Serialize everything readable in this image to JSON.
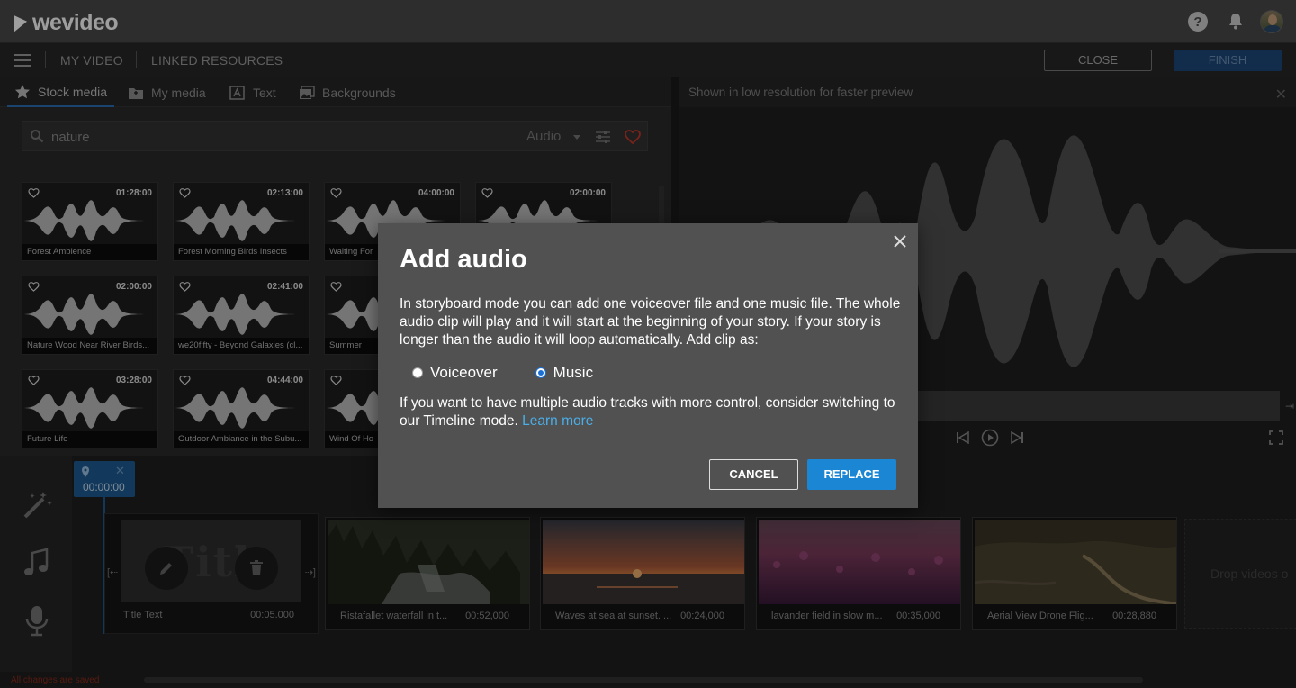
{
  "app": {
    "logo_text": "wevideo"
  },
  "header": {
    "icons": [
      "help-icon",
      "bell-icon",
      "avatar"
    ]
  },
  "subbar": {
    "my_video": "MY VIDEO",
    "linked_resources": "LINKED RESOURCES",
    "close_label": "CLOSE",
    "finish_label": "FINISH"
  },
  "media": {
    "tabs": [
      {
        "label": "Stock media",
        "icon": "star-icon"
      },
      {
        "label": "My media",
        "icon": "folder-icon"
      },
      {
        "label": "Text",
        "icon": "text-icon"
      },
      {
        "label": "Backgrounds",
        "icon": "image-icon"
      }
    ],
    "search": {
      "value": "nature",
      "placeholder": ""
    },
    "type_select": "Audio",
    "items": [
      {
        "name": "Forest Ambience",
        "duration": "01:28:00"
      },
      {
        "name": "Forest Morning Birds Insects",
        "duration": "02:13:00"
      },
      {
        "name": "Waiting For",
        "duration": "04:00:00"
      },
      {
        "name": "",
        "duration": "02:00:00"
      },
      {
        "name": "Nature Wood Near River Birds...",
        "duration": "02:00:00"
      },
      {
        "name": "we20fifty - Beyond Galaxies (cl...",
        "duration": "02:41:00"
      },
      {
        "name": "Summer",
        "duration": ""
      },
      {
        "name": "Future Life",
        "duration": "03:28:00"
      },
      {
        "name": "Outdoor Ambiance in the Subu...",
        "duration": "04:44:00"
      },
      {
        "name": "Wind Of Ho",
        "duration": ""
      }
    ]
  },
  "preview": {
    "note": "Shown in low resolution for faster preview"
  },
  "storyboard": {
    "playhead_time": "00:00:00",
    "title_clip": {
      "word": "Title",
      "name": "Title Text",
      "duration": "00:05.000"
    },
    "clips": [
      {
        "name": "Ristafallet waterfall in t...",
        "duration": "00:52,000"
      },
      {
        "name": "Waves at sea at sunset. ...",
        "duration": "00:24,000"
      },
      {
        "name": "lavander field in slow m...",
        "duration": "00:35,000"
      },
      {
        "name": "Aerial View Drone Flig...",
        "duration": "00:28,880"
      }
    ],
    "drop_zone": "Drop videos o",
    "saved_note": "All changes are saved"
  },
  "modal": {
    "title": "Add audio",
    "text": "In storyboard mode you can add one voiceover file and one music file. The whole audio clip will play and it will start at the beginning of your story. If your story is longer than the audio it will loop automatically. Add clip as:",
    "options": [
      {
        "label": "Voiceover",
        "selected": false
      },
      {
        "label": "Music",
        "selected": true
      }
    ],
    "text2": "If you want to have multiple audio tracks with more control, consider switching to our Timeline mode.",
    "learn_more": "Learn more",
    "cancel_label": "CANCEL",
    "replace_label": "REPLACE"
  },
  "colors": {
    "accent": "#1a86d4",
    "link": "#4aaee8",
    "topbar": "#4a4a4a",
    "modal_bg": "#515151"
  }
}
